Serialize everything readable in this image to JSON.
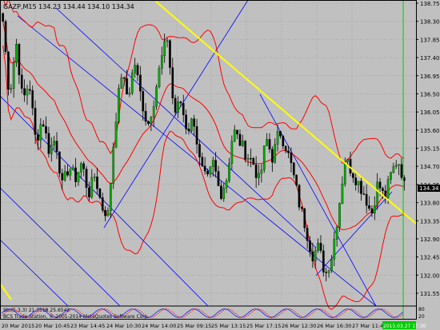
{
  "window": {
    "symbol_header": "GAZP,M15 134.23 134.44 134.10 134.34",
    "copyright": "BCS Trade Station, © 2001-2014 MetaQuotes Software Corp."
  },
  "indicator": {
    "label": "Sto(5,3,3) 21.3518 25.6542",
    "scale_top": "80",
    "scale_bottom": "20"
  },
  "price_axis": {
    "labels": [
      "138.75",
      "138.30",
      "137.85",
      "137.40",
      "136.95",
      "136.50",
      "136.05",
      "135.60",
      "135.15",
      "134.70",
      "134.25",
      "133.80",
      "133.35",
      "132.90",
      "132.45",
      "132.00",
      "131.55"
    ],
    "current_price": "134.34"
  },
  "time_axis": {
    "labels": [
      "20 Mar 2015",
      "20 Mar 10:45",
      "23 Mar 14:45",
      "24 Mar 10:30",
      "24 Mar 14:00",
      "25 Mar 09:15",
      "25 Mar 13:15",
      "25 Mar 17:15",
      "26 Mar 12:30",
      "26 Mar 16:30",
      "27 Mar 11:45"
    ],
    "current_time": "2015.03.27 17:30"
  },
  "colors": {
    "background": "#c0c0c0",
    "bull_candle": "#00b000",
    "bear_candle": "#000000",
    "bollinger": "#ff0000",
    "yellow_line": "#ffff00",
    "channel_lines": "#0000ff",
    "vertical_marker": "#00cc00",
    "price_marker": "#000000"
  },
  "chart_data": {
    "type": "candlestick",
    "symbol": "GAZP",
    "timeframe": "M15",
    "last_bar": {
      "open": 134.23,
      "high": 134.44,
      "low": 134.1,
      "close": 134.34
    },
    "y_range": [
      131.55,
      138.75
    ],
    "close_path": [
      138.3,
      136.4,
      137.8,
      136.3,
      136.8,
      135.3,
      135.9,
      135.1,
      135.4,
      134.2,
      134.7,
      134.4,
      134.8,
      134.0,
      134.5,
      133.7,
      133.5,
      135.7,
      137.0,
      136.4,
      137.3,
      136.4,
      135.7,
      136.4,
      137.3,
      137.9,
      136.0,
      136.3,
      135.6,
      135.9,
      134.7,
      134.3,
      134.8,
      134.0,
      134.4,
      135.6,
      135.3,
      135.0,
      134.8,
      134.3,
      135.4,
      134.9,
      135.6,
      135.2,
      134.6,
      133.8,
      133.2,
      132.5,
      132.7,
      132.0,
      132.5,
      133.6,
      134.9,
      134.6,
      134.3,
      134.0,
      133.5,
      134.3,
      133.9,
      134.5,
      134.9,
      134.34
    ],
    "bollinger_bands": {
      "period": 20,
      "lines": [
        "upper",
        "middle",
        "lower"
      ]
    }
  }
}
